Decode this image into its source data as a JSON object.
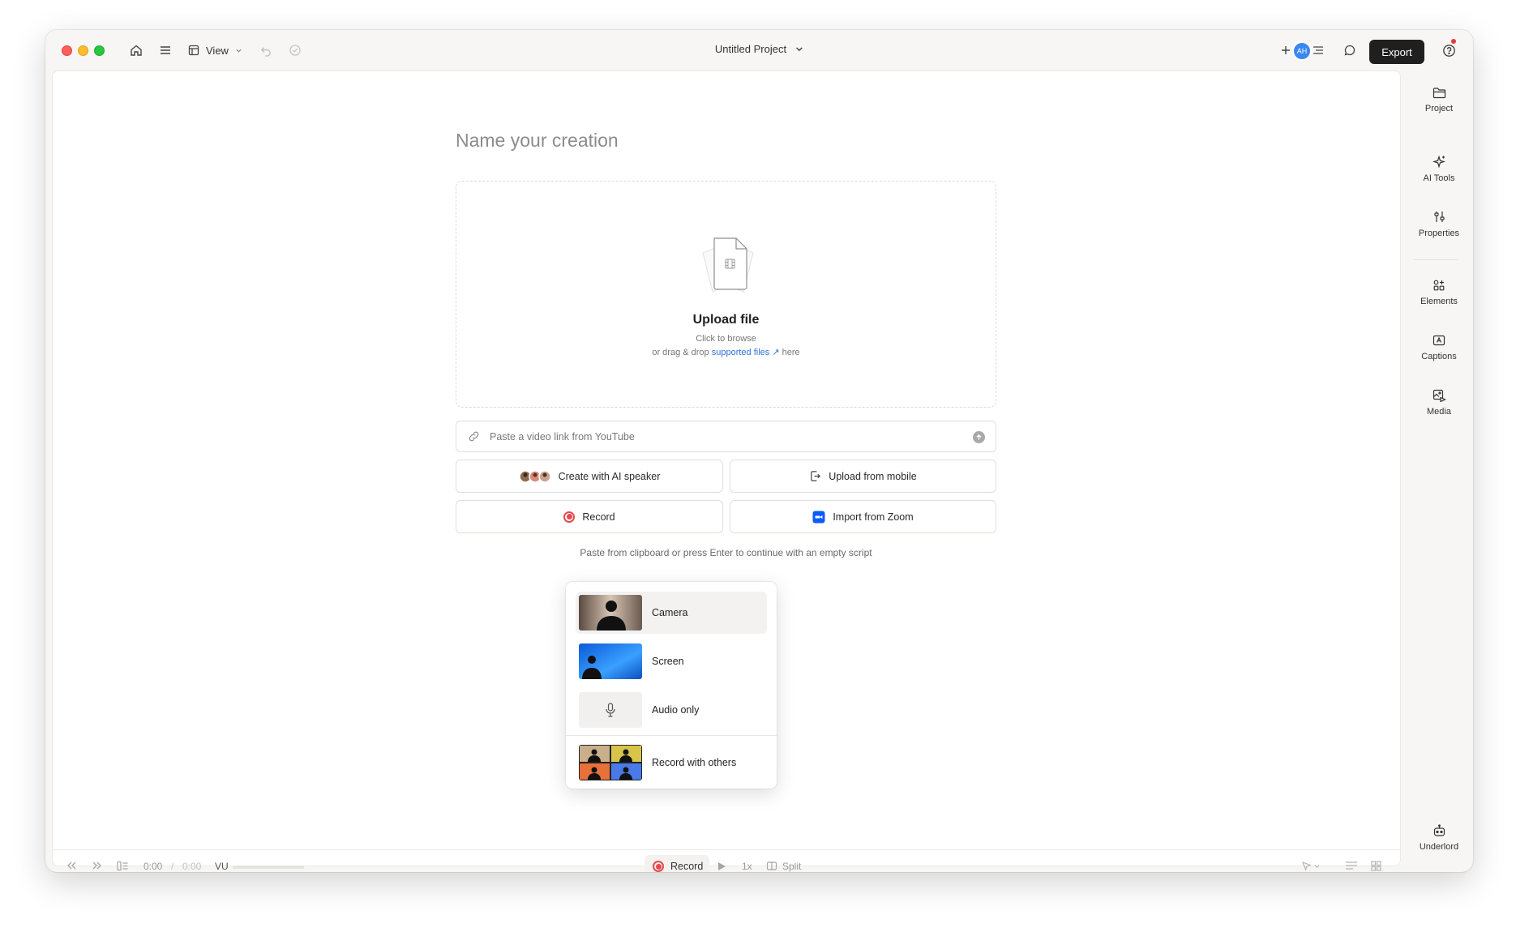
{
  "toolbar": {
    "view_label": "View",
    "project_title": "Untitled Project",
    "export_label": "Export",
    "avatar_initials": "AH"
  },
  "main": {
    "name_placeholder": "Name your creation",
    "upload_title": "Upload file",
    "upload_sub1": "Click to browse",
    "upload_sub2_prefix": "or drag & drop",
    "upload_sub2_link": "supported files ↗",
    "upload_sub2_suffix": "here",
    "link_placeholder": "Paste a video link from YouTube",
    "buttons": {
      "ai_speaker": "Create with AI speaker",
      "upload_mobile": "Upload from mobile",
      "record": "Record",
      "import_zoom": "Import from Zoom"
    },
    "hint": "Paste from clipboard or press Enter to continue with an empty script"
  },
  "record_menu": {
    "items": [
      {
        "label": "Camera"
      },
      {
        "label": "Screen"
      },
      {
        "label": "Audio only"
      },
      {
        "label": "Record with others"
      }
    ]
  },
  "bottombar": {
    "time_current": "0:00",
    "time_sep": "/",
    "time_total": "0:00",
    "vu_label": "VU",
    "record_label": "Record",
    "speed_label": "1x",
    "split_label": "Split"
  },
  "sidebar": {
    "items": [
      {
        "label": "Project"
      },
      {
        "label": "AI Tools"
      },
      {
        "label": "Properties"
      },
      {
        "label": "Elements"
      },
      {
        "label": "Captions"
      },
      {
        "label": "Media"
      },
      {
        "label": "Underlord"
      }
    ]
  },
  "colors": {
    "accent_blue": "#2f6fdc",
    "record_red": "#e5484d",
    "export_bg": "#1f1f1f"
  }
}
